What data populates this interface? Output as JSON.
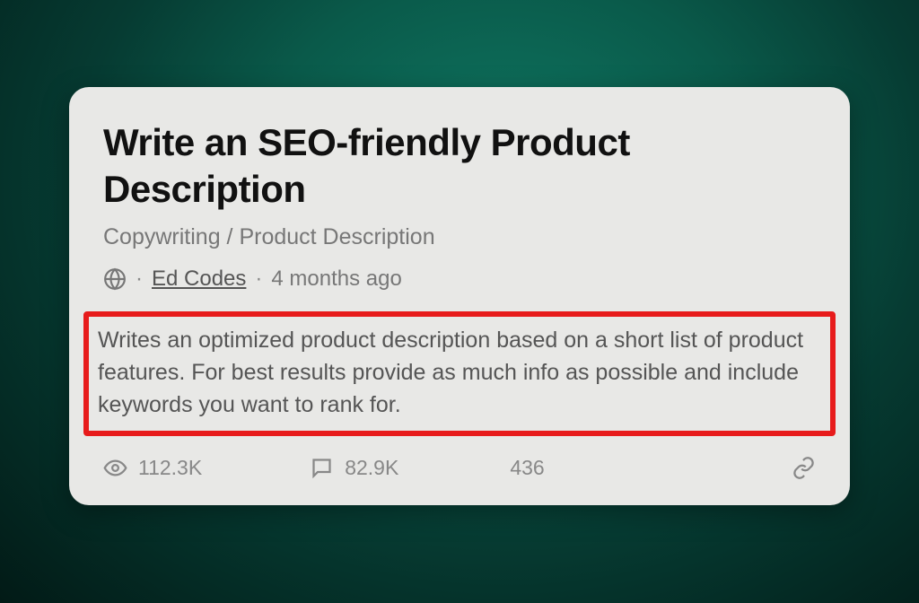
{
  "card": {
    "title": "Write an SEO-friendly Product Description",
    "category": "Copywriting / Product Description",
    "author": "Ed Codes",
    "time": "4 months ago",
    "description": "Writes an optimized product description based on a short list of product features. For best results provide as much info as possible and include keywords you want to rank for.",
    "stats": {
      "views": "112.3K",
      "comments": "82.9K",
      "likes": "436"
    }
  }
}
